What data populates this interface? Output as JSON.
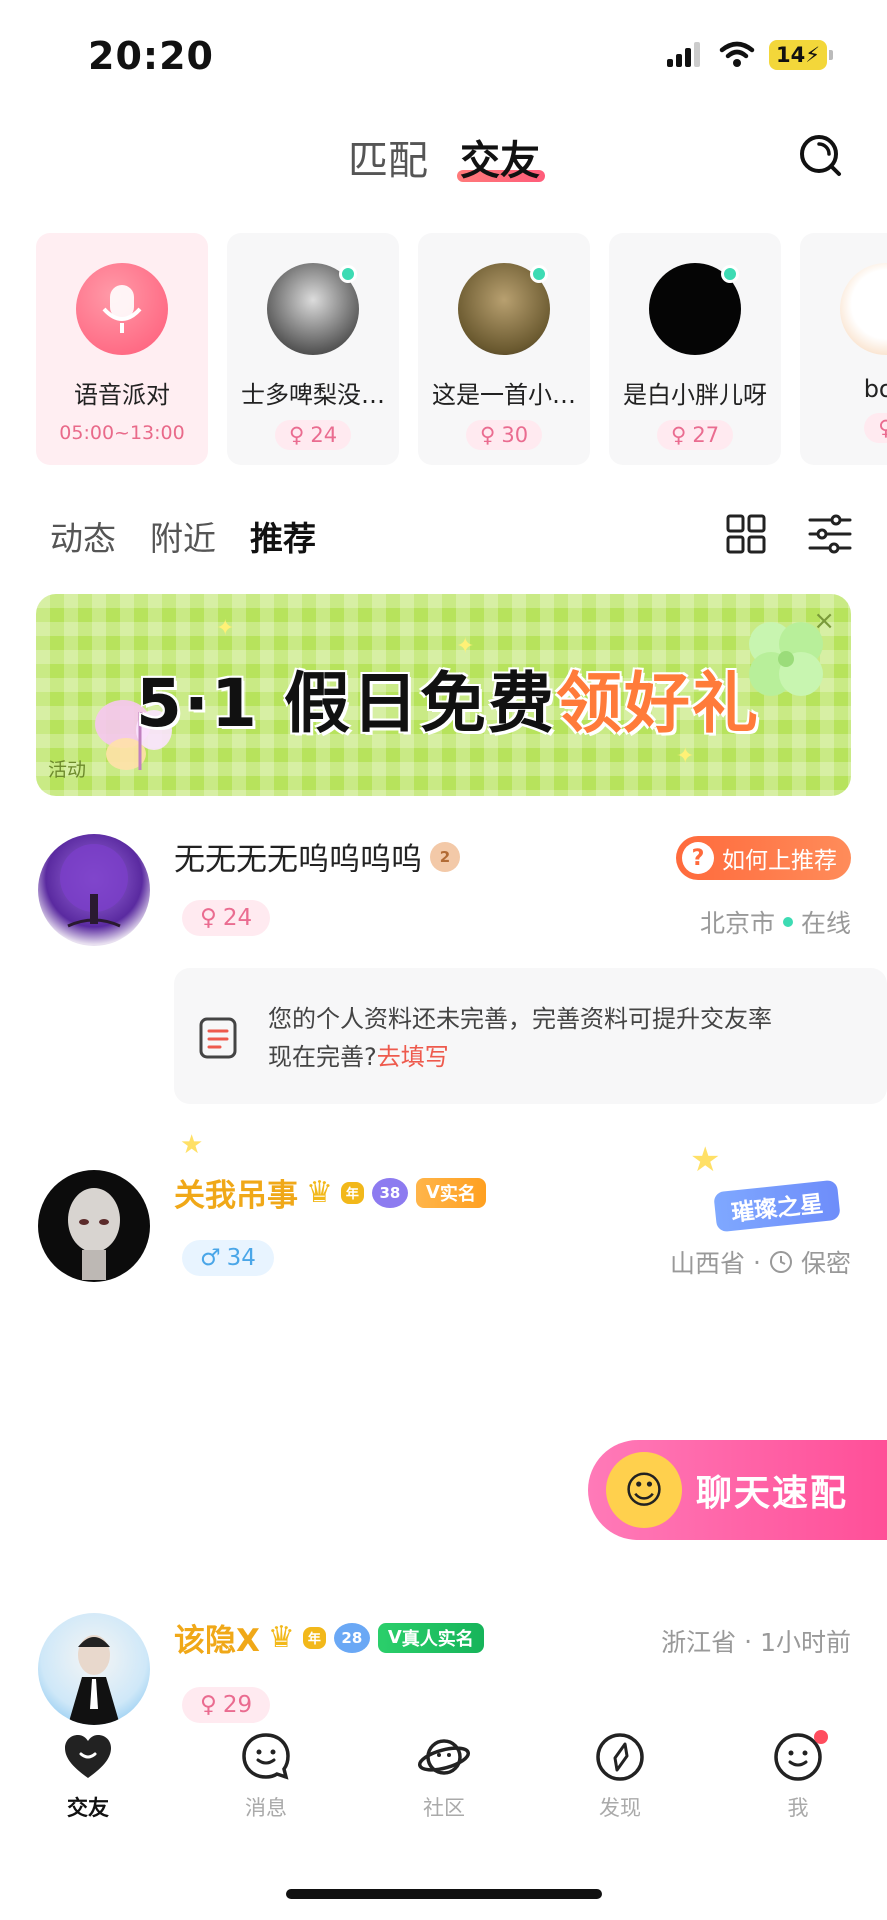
{
  "status_bar": {
    "time": "20:20",
    "battery": "14"
  },
  "top_tabs": {
    "match": "匹配",
    "friends": "交友"
  },
  "stories": [
    {
      "name": "语音派对",
      "sub": "05:00~13:00"
    },
    {
      "name": "士多啤梨没…",
      "age": "24"
    },
    {
      "name": "这是一首小…",
      "age": "30"
    },
    {
      "name": "是白小胖儿呀",
      "age": "27"
    },
    {
      "name": "boo"
    }
  ],
  "feed_tabs": [
    "动态",
    "附近",
    "推荐"
  ],
  "banner": {
    "title_part1": "5·1 假日免费",
    "title_part2": "领好礼",
    "tag": "活动",
    "close": "×"
  },
  "posts": [
    {
      "name": "无无无无呜呜呜呜",
      "level": "2",
      "age": "24",
      "location": "北京市",
      "status": "在线",
      "recommend_label": "如何上推荐",
      "recommend_q": "?"
    },
    {
      "name": "关我吊事",
      "crown_label": "年",
      "level": "38",
      "verified": "实名",
      "age": "34",
      "location": "山西省",
      "status": "保密",
      "star_badge": "璀璨之星"
    },
    {
      "name": "该隐X",
      "crown_label": "年",
      "level": "28",
      "verified": "真人实名",
      "age": "29",
      "location": "浙江省",
      "status": "1小时前"
    }
  ],
  "profile_tip": {
    "line1": "您的个人资料还未完善，完善资料可提升交友率",
    "line2": "现在完善?",
    "link": "去填写"
  },
  "chat_match": {
    "label": "聊天速配"
  },
  "bottom_nav": [
    {
      "label": "交友"
    },
    {
      "label": "消息"
    },
    {
      "label": "社区"
    },
    {
      "label": "发现"
    },
    {
      "label": "我"
    }
  ]
}
